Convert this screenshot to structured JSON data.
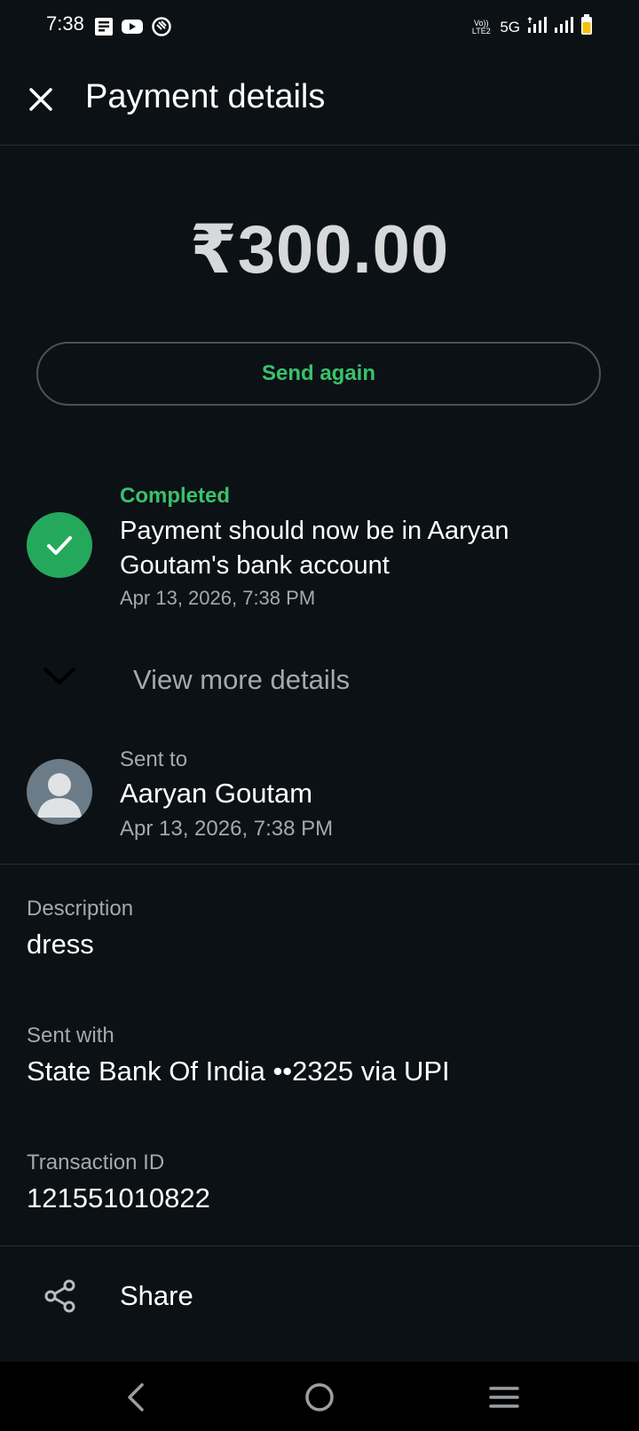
{
  "status_bar": {
    "time": "7:38",
    "left_icons": [
      "notes-icon",
      "youtube-icon",
      "shield-icon"
    ],
    "volte_label": "Vo)) LTE2",
    "network": "5G",
    "battery_color": "#f4c20d"
  },
  "header": {
    "title": "Payment details",
    "close_icon": "close-icon"
  },
  "payment": {
    "amount": "₹300.00",
    "send_again_label": "Send again"
  },
  "status": {
    "label": "Completed",
    "message": "Payment should now be in Aaryan Goutam's bank account",
    "date": "Apr 13, 2026, 7:38 PM",
    "accent_color": "#39c26b"
  },
  "more_details": {
    "label": "View more details"
  },
  "recipient": {
    "label": "Sent to",
    "name": "Aaryan Goutam",
    "date": "Apr 13, 2026, 7:38 PM"
  },
  "details": {
    "description_label": "Description",
    "description_value": "dress",
    "sent_with_label": "Sent with",
    "sent_with_value": "State Bank Of India ••2325 via UPI",
    "transaction_label": "Transaction ID",
    "transaction_value": "121551010822"
  },
  "share": {
    "label": "Share"
  },
  "nav": {
    "icons": [
      "back-icon",
      "home-icon",
      "menu-icon"
    ]
  }
}
